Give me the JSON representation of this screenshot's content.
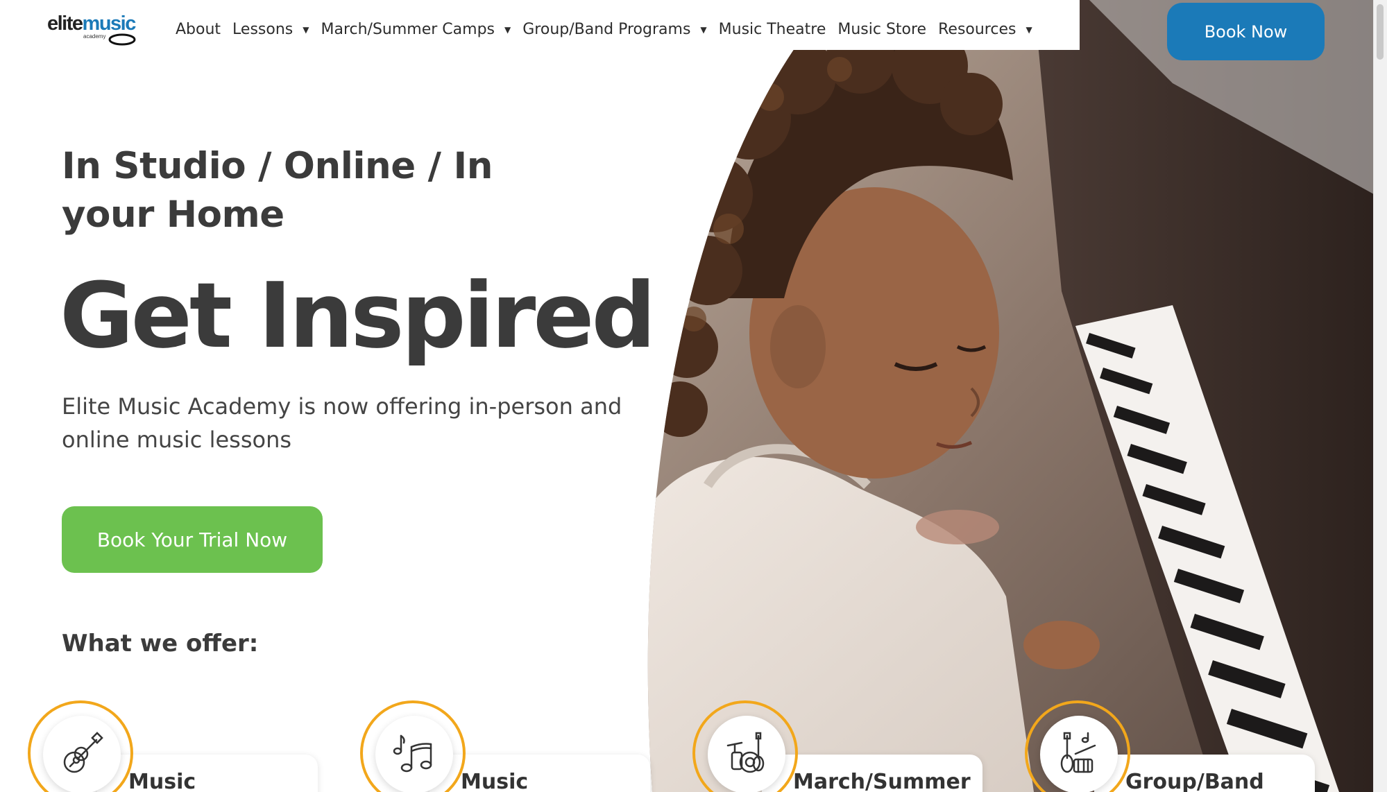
{
  "brand": {
    "logo_word1": "elite",
    "logo_word2": "music",
    "logo_sub": "academy",
    "primary_color": "#1b7ab8",
    "accent_green": "#6cc14f",
    "accent_orange": "#f2a71b"
  },
  "nav": {
    "items": [
      {
        "label": "About",
        "has_dropdown": false
      },
      {
        "label": "Lessons",
        "has_dropdown": true
      },
      {
        "label": "March/Summer Camps",
        "has_dropdown": true
      },
      {
        "label": "Group/Band Programs",
        "has_dropdown": true
      },
      {
        "label": "Music Theatre",
        "has_dropdown": false
      },
      {
        "label": "Music Store",
        "has_dropdown": false
      },
      {
        "label": "Resources",
        "has_dropdown": true
      }
    ],
    "caret_glyph": "▼",
    "book_now_label": "Book Now"
  },
  "hero": {
    "subtitle": "In Studio / Online / In your Home",
    "title": "Get Inspired",
    "description": "Elite Music Academy is now offering in-person and online music lessons",
    "cta_label": "Book Your Trial Now",
    "image_icon": "girl-playing-piano-photo"
  },
  "offers": {
    "heading": "What we offer:",
    "cards": [
      {
        "label": "Music",
        "icon": "guitar-icon"
      },
      {
        "label": "Music",
        "icon": "music-notes-icon"
      },
      {
        "label": "March/Summer",
        "icon": "drum-guitar-icon"
      },
      {
        "label": "Group/Band",
        "icon": "band-instruments-icon"
      }
    ]
  }
}
